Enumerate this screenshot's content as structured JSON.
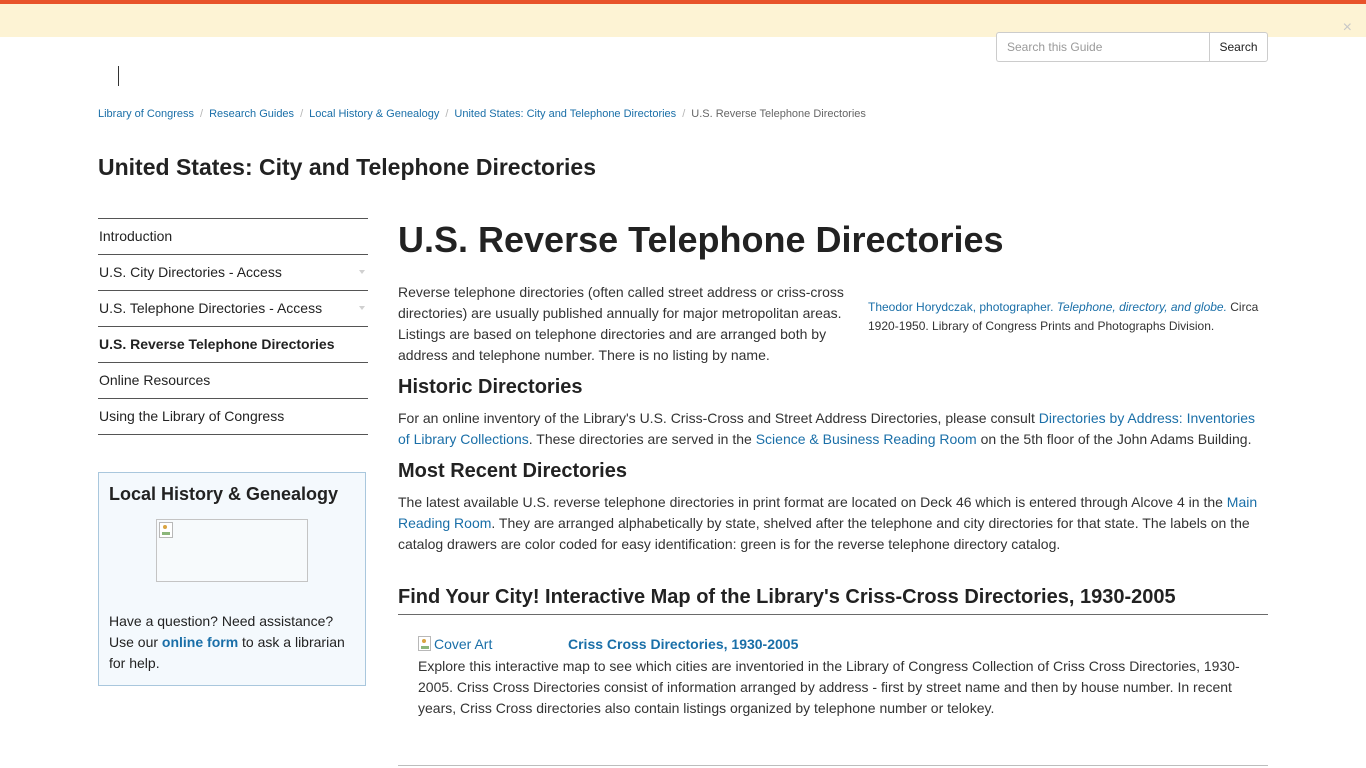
{
  "alert": {
    "close_glyph": "×"
  },
  "search": {
    "placeholder": "Search this Guide",
    "button_label": "Search"
  },
  "breadcrumb": {
    "items": [
      "Library of Congress",
      "Research Guides",
      "Local History & Genealogy",
      "United States: City and Telephone Directories"
    ],
    "separator": "/",
    "current": "U.S. Reverse Telephone Directories"
  },
  "guide_title": "United States: City and Telephone Directories",
  "sidebar": {
    "items": [
      {
        "label": "Introduction"
      },
      {
        "label": "U.S. City Directories - Access"
      },
      {
        "label": "U.S. Telephone Directories - Access"
      },
      {
        "label": "U.S. Reverse Telephone Directories"
      },
      {
        "label": "Online Resources"
      },
      {
        "label": "Using the Library of Congress"
      }
    ],
    "box": {
      "title": "Local History & Genealogy",
      "text_before": "Have a question? Need assistance? Use our ",
      "link": "online form",
      "text_after": " to ask a librarian for help."
    }
  },
  "main": {
    "page_title": "U.S. Reverse Telephone Directories",
    "intro": "Reverse telephone directories (often called street address or criss-cross directories) are usually published annually for major metropolitan areas. Listings are based on telephone directories and are arranged both by address and telephone number. There is no listing by name.",
    "figure": {
      "photographer": "Theodor Horydczak, photographer.",
      "photo_title": "Telephone, directory, and globe.",
      "caption": " Circa 1920-1950. Library of Congress Prints and Photographs Division."
    },
    "historic": {
      "heading": "Historic Directories",
      "text1": "For an online inventory of the Library's U.S. Criss-Cross and Street Address Directories, please consult ",
      "link1": "Directories by Address: Inventories of Library Collections",
      "text2": ". These directories are served in the ",
      "link2": "Science & Business Reading Room",
      "text3": " on the 5th floor of the John Adams Building."
    },
    "recent": {
      "heading": "Most Recent Directories",
      "text1": "The latest available U.S. reverse telephone directories in print format are located on Deck 46 which is entered through Alcove 4 in the ",
      "link1": "Main Reading Room",
      "text2": ". They are arranged alphabetically by state, shelved after the telephone and city directories for that state. The labels on the catalog drawers are color coded for easy identification: green is for the reverse telephone directory catalog."
    },
    "map_section": {
      "heading": "Find Your City! Interactive Map of the Library's Criss-Cross Directories, 1930-2005",
      "cover_alt": "Cover Art",
      "link": "Criss Cross Directories, 1930-2005",
      "description": "Explore this interactive map to see which cities are inventoried in the Library of Congress Collection of Criss Cross Directories, 1930-2005. Criss Cross Directories consist of information arranged by address - first by street name and then by house number. In recent years, Criss Cross directories also contain listings organized by telephone number or telokey."
    }
  },
  "colors": {
    "accent_stripe": "#e8532a",
    "alert_bg": "#fdf3d4",
    "link": "#1a6fa8",
    "sidebar_box_bg": "#f4f9fd"
  },
  "icons": [
    "close-icon",
    "broken-image-icon",
    "chevron-down-icon"
  ]
}
